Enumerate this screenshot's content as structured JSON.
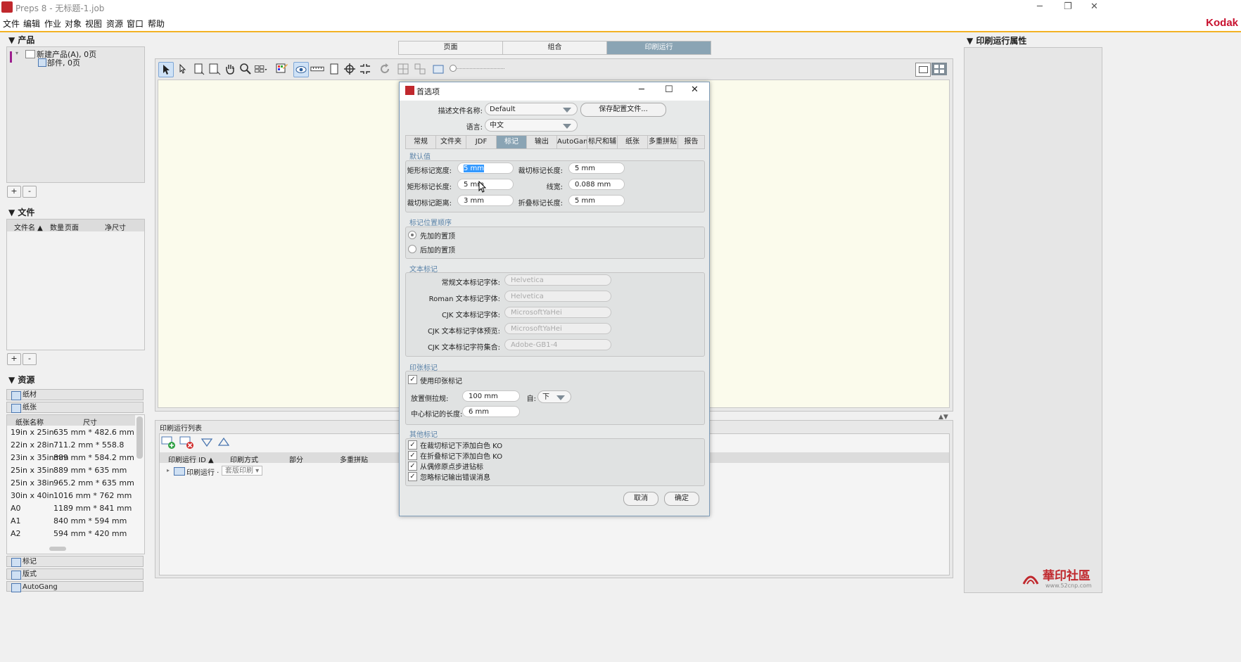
{
  "window": {
    "title": "Preps 8 - 无标题-1.job",
    "brand": "Kodak"
  },
  "menu": [
    "文件",
    "编辑",
    "作业",
    "对象",
    "视图",
    "资源",
    "窗口",
    "帮助"
  ],
  "left": {
    "products_title": "▼ 产品",
    "product_tree": [
      "新建产品(A), 0页",
      "部件, 0页"
    ],
    "files_title": "▼ 文件",
    "file_columns": [
      "文件名 ▲",
      "数量",
      "页面",
      "净尺寸"
    ],
    "resources_title": "▼ 资源",
    "resource_tabs": [
      "纸材",
      "纸张"
    ],
    "paper_columns": [
      "纸张名称",
      "尺寸"
    ],
    "papers": [
      [
        "19in x 25in",
        "635 mm * 482.6 mm"
      ],
      [
        "22in x 28in",
        "711.2 mm * 558.8 mm"
      ],
      [
        "23in x 35in",
        "889 mm * 584.2 mm"
      ],
      [
        "25in x 35in",
        "889 mm * 635 mm"
      ],
      [
        "25in x 38in",
        "965.2 mm * 635 mm"
      ],
      [
        "30in x 40in",
        "1016 mm * 762 mm"
      ],
      [
        "A0",
        "1189 mm * 841 mm"
      ],
      [
        "A1",
        "840 mm * 594 mm"
      ],
      [
        "A2",
        "594 mm * 420 mm"
      ]
    ],
    "bottom_tabs": [
      "标记",
      "版式",
      "AutoGang"
    ]
  },
  "center": {
    "tabs": [
      "页面",
      "组合",
      "印刷运行"
    ],
    "runlist_title": "印刷运行列表",
    "runlist_columns": [
      "印刷运行 ID ▲",
      "印刷方式",
      "部分",
      "多重拼贴"
    ],
    "runlist_row": {
      "id": "印刷运行 ·",
      "method": "套版印刷"
    }
  },
  "right": {
    "title": "▼ 印刷运行属性"
  },
  "dialog": {
    "title": "首选项",
    "profile_label": "描述文件名称:",
    "profile_value": "Default",
    "save_button": "保存配置文件...",
    "language_label": "语言:",
    "language_value": "中文",
    "tabs": [
      "常规",
      "文件夹",
      "JDF",
      "标记",
      "输出",
      "AutoGang",
      "标尺和辅助",
      "纸张",
      "多重拼贴",
      "报告"
    ],
    "defaults_title": "默认值",
    "defaults": {
      "rect_width_label": "矩形标记宽度:",
      "rect_width": "5 mm",
      "cut_len_label": "裁切标记长度:",
      "cut_len": "5 mm",
      "rect_len_label": "矩形标记长度:",
      "rect_len": "5 mm",
      "line_width_label": "线宽:",
      "line_width": "0.088 mm",
      "cut_dist_label": "裁切标记距离:",
      "cut_dist": "3 mm",
      "fold_len_label": "折叠标记长度:",
      "fold_len": "5 mm"
    },
    "order_title": "标记位置顺序",
    "order_options": [
      "先加的置顶",
      "后加的置顶"
    ],
    "text_title": "文本标记",
    "text_fonts": [
      [
        "常规文本标记字体:",
        "Helvetica"
      ],
      [
        "Roman 文本标记字体:",
        "Helvetica"
      ],
      [
        "CJK 文本标记字体:",
        "MicrosoftYaHei"
      ],
      [
        "CJK 文本标记字体预览:",
        "MicrosoftYaHei"
      ],
      [
        "CJK 文本标记字符集合:",
        "Adobe-GB1-4"
      ]
    ],
    "sheet_title": "印张标记",
    "sheet_use": "使用印张标记",
    "sheet_side_label": "放置侧拉规:",
    "sheet_side_value": "100 mm",
    "sheet_from_label": "自:",
    "sheet_from_value": "下",
    "sheet_center_label": "中心标记的长度:",
    "sheet_center_value": "6 mm",
    "other_title": "其他标记",
    "other_options": [
      "在裁切标记下添加白色 KO",
      "在折叠标记下添加白色 KO",
      "从偶修原点步进钻标",
      "忽略标记输出错误消息"
    ],
    "cancel": "取消",
    "ok": "确定"
  },
  "watermark": {
    "text": "華印社區",
    "url": "www.52cnp.com"
  },
  "colors": {
    "accent": "#f3b224",
    "tab_active": "#8aa4b4",
    "kodak": "#c8102e"
  }
}
